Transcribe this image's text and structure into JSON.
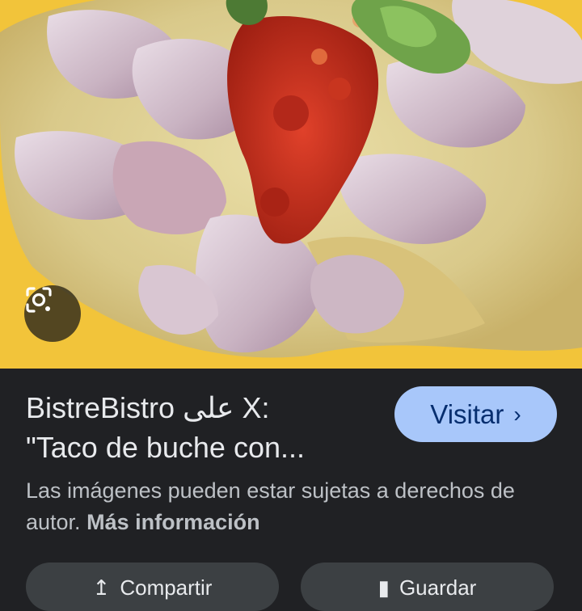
{
  "image": {
    "alt": "",
    "lens_icon": "camera-lens-icon"
  },
  "result": {
    "title_line1": "BistreBistro على X:",
    "title_line2": "\"Taco de buche con...",
    "visit_label": "Visitar",
    "visit_icon": "chevron-right-icon"
  },
  "notice": {
    "text": "Las imágenes pueden estar sujetas a derechos de autor.",
    "more_link": "Más información"
  },
  "actions": {
    "left_label": "Compartir",
    "left_icon": "share-icon",
    "right_label": "Guardar",
    "right_icon": "bookmark-icon"
  },
  "colors": {
    "background": "#202124",
    "button": "#a8c7fa",
    "button_text": "#062e6f",
    "plate": "#f2c43a"
  }
}
